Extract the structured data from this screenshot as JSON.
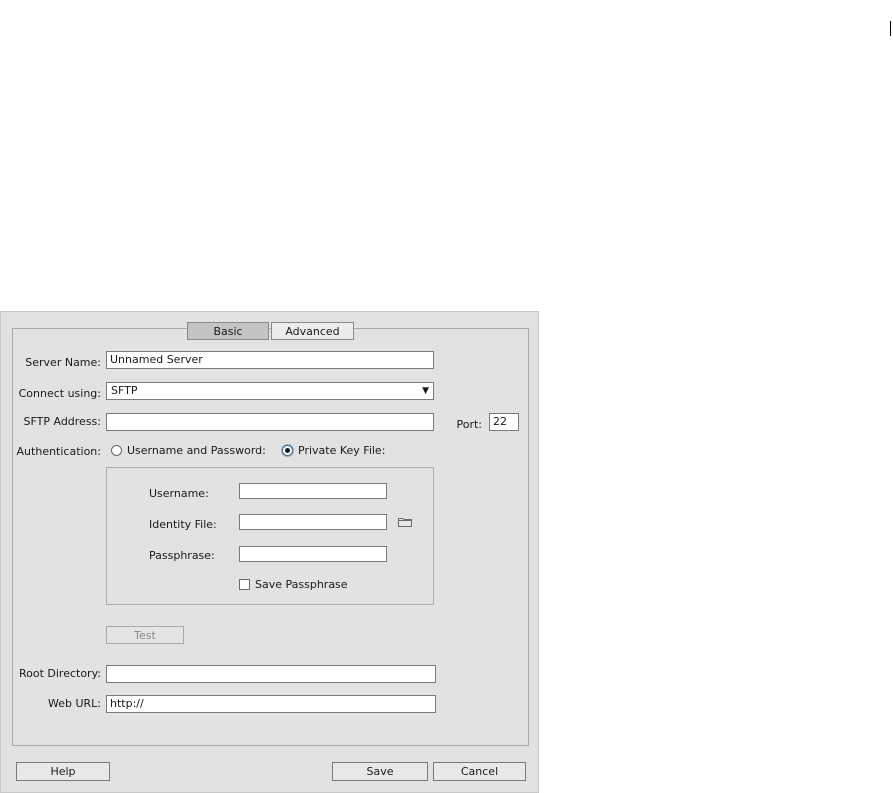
{
  "tabs": {
    "basic": "Basic",
    "advanced": "Advanced"
  },
  "server_name": {
    "label": "Server Name:",
    "value": "Unnamed Server"
  },
  "connect_using": {
    "label": "Connect using:",
    "value": "SFTP"
  },
  "sftp_address": {
    "label": "SFTP Address:",
    "value": ""
  },
  "port": {
    "label": "Port:",
    "value": "22"
  },
  "authentication": {
    "label": "Authentication:",
    "option_password": "Username and Password:",
    "option_key": "Private Key File:",
    "selected": "Private Key File:"
  },
  "key_panel": {
    "username_label": "Username:",
    "username_value": "",
    "identity_label": "Identity File:",
    "identity_value": "",
    "passphrase_label": "Passphrase:",
    "passphrase_value": "",
    "save_passphrase_label": "Save Passphrase",
    "save_passphrase_checked": false
  },
  "test_button": "Test",
  "root_directory": {
    "label": "Root Directory:",
    "value": ""
  },
  "web_url": {
    "label": "Web URL:",
    "value": "http://"
  },
  "footer": {
    "help": "Help",
    "save": "Save",
    "cancel": "Cancel"
  },
  "icons": {
    "dropdown": "triangle-down-icon",
    "browse": "folder-icon"
  }
}
